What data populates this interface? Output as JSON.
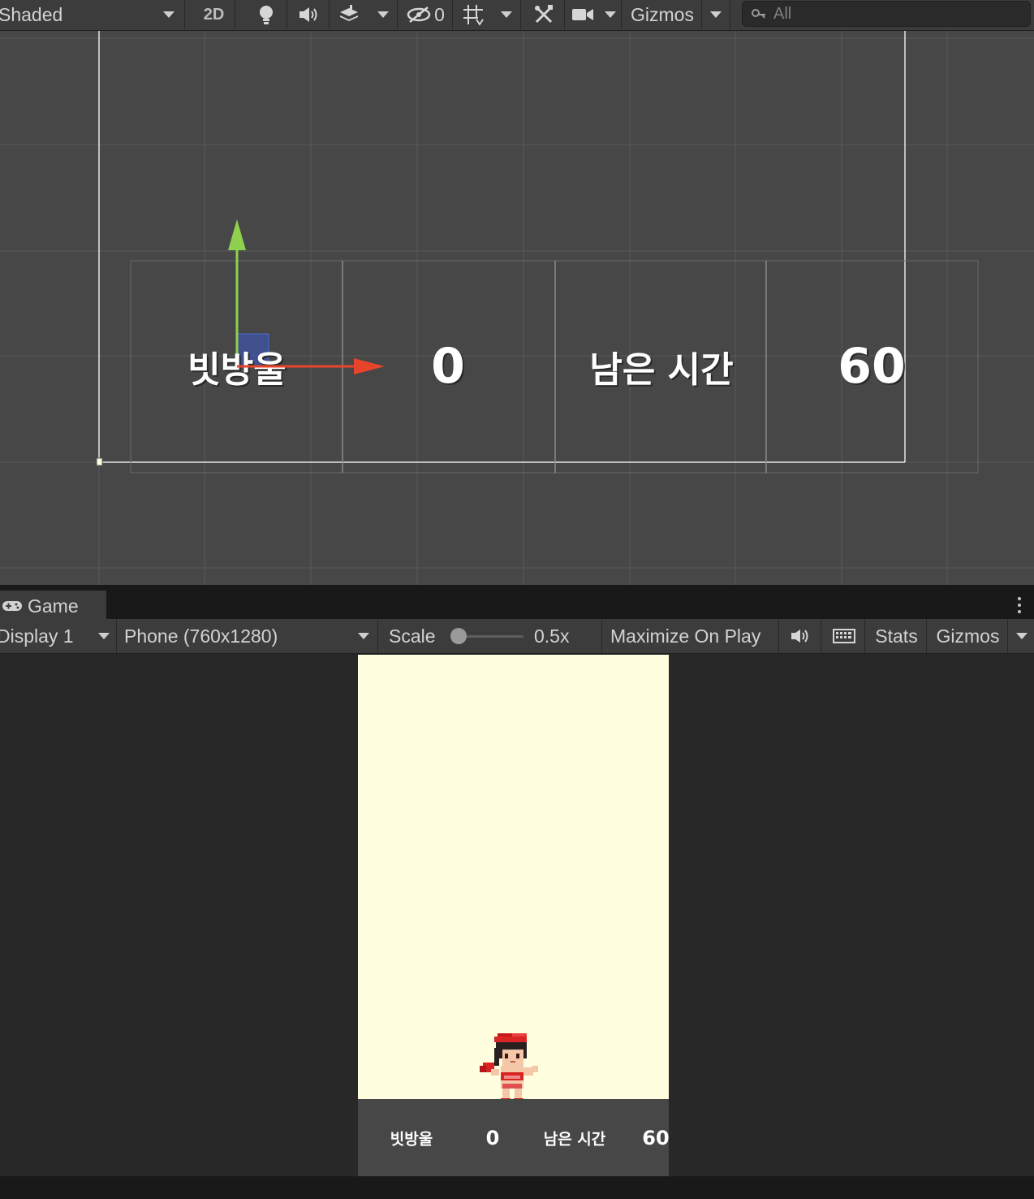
{
  "scene_toolbar": {
    "shading_mode": "Shaded",
    "mode_2d_label": "2D",
    "hidden_count": "0",
    "gizmos_label": "Gizmos",
    "search_placeholder": "All",
    "icons": [
      "lighting-icon",
      "audio-icon",
      "effects-icon",
      "visibility-icon",
      "grid-icon",
      "tools-icon",
      "camera-icon",
      "search-icon"
    ]
  },
  "scene_view": {
    "labels": {
      "rain_label": "빗방울",
      "score_value": "0",
      "time_label": "남은 시간",
      "time_value": "60"
    },
    "colors": {
      "background": "#474747",
      "x_axis": "#e8442c",
      "y_axis": "#8fd14f",
      "rect_handle": "#4a6cd4"
    }
  },
  "game_tab": {
    "title": "Game",
    "icon": "gamepad-icon"
  },
  "game_toolbar": {
    "display": "Display 1",
    "resolution": "Phone (760x1280)",
    "scale_label": "Scale",
    "scale_value": "0.5x",
    "maximize_label": "Maximize On Play",
    "stats_label": "Stats",
    "gizmos_label": "Gizmos",
    "icons": [
      "mute-audio-icon",
      "keyboard-icon"
    ]
  },
  "game_view": {
    "background": "#fffedf",
    "hud": {
      "rain_label": "빗방울",
      "score_value": "0",
      "time_label": "남은 시간",
      "time_value": "60"
    },
    "player": "player-character"
  }
}
